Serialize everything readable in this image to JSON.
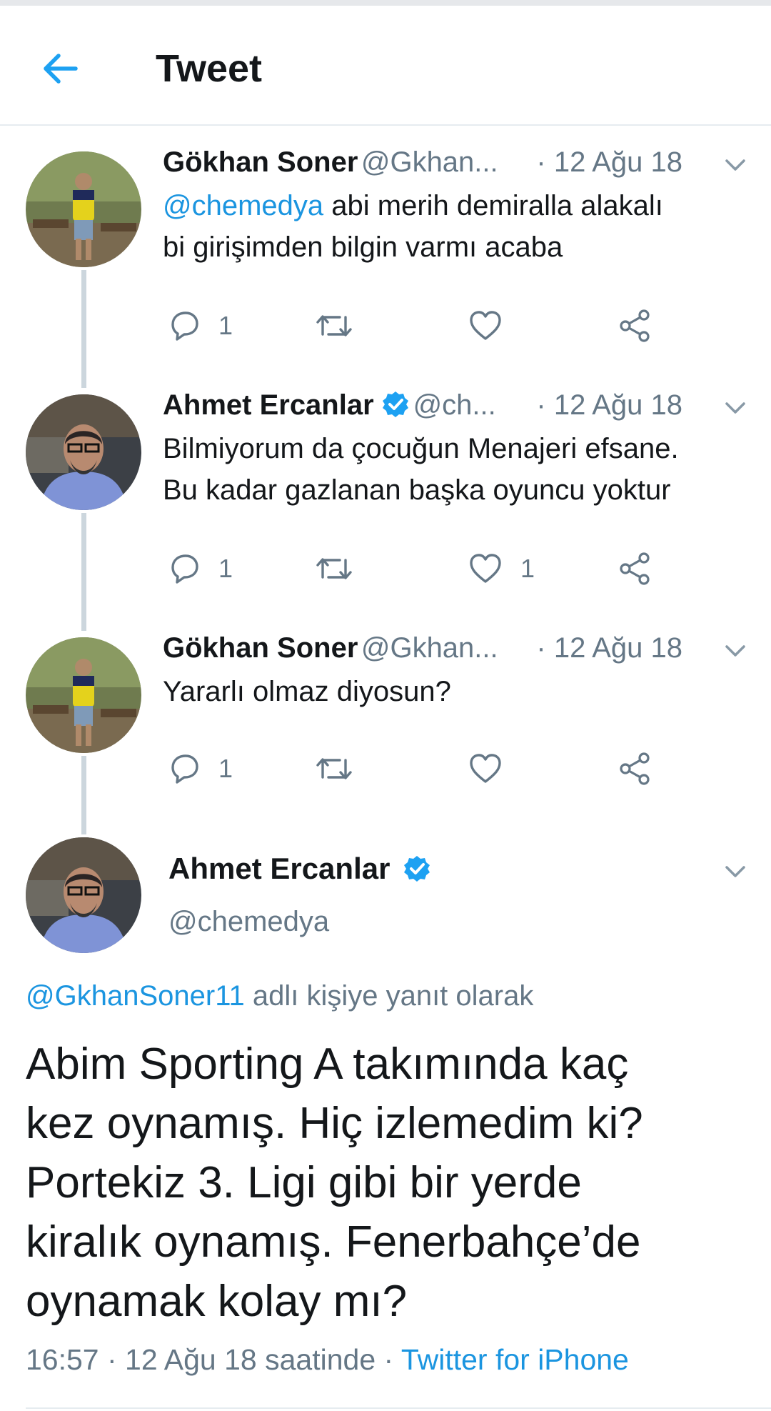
{
  "header": {
    "title": "Tweet"
  },
  "replies": [
    {
      "name": "Gökhan Soner",
      "handle": "@Gkhan...",
      "date": "· 12 Ağu 18",
      "mention": "@chemedya",
      "text_line1": " abi merih demiralla alakalı",
      "text_line2": "bi girişimden bilgin varmı acaba",
      "reply_count": "1",
      "like_count": "",
      "verified": false
    },
    {
      "name": "Ahmet Ercanlar",
      "handle": "@ch...",
      "date": "· 12 Ağu 18",
      "text_line1": "Bilmiyorum da çocuğun Menajeri efsane.",
      "text_line2": "Bu kadar gazlanan başka oyuncu yoktur",
      "reply_count": "1",
      "like_count": "1",
      "verified": true
    },
    {
      "name": "Gökhan Soner",
      "handle": "@Gkhan...",
      "date": "· 12 Ağu 18",
      "text_line1": "Yararlı olmaz diyosun?",
      "reply_count": "1",
      "like_count": "",
      "verified": false
    }
  ],
  "main_tweet": {
    "name": "Ahmet Ercanlar",
    "handle": "@chemedya",
    "reply_to_handle": "@GkhanSoner11",
    "reply_to_suffix": " adlı kişiye yanıt olarak",
    "text_lines": [
      "Abim Sporting A takımında kaç",
      "kez oynamış. Hiç izlemedim ki?",
      "Portekiz 3. Ligi gibi bir yerde",
      "kiralık oynamış. Fenerbahçe’de",
      "oynamak kolay mı?"
    ],
    "time": "16:57",
    "date_text": " · 12 Ağu 18 saatinde · ",
    "source": "Twitter for iPhone"
  },
  "colors": {
    "accent": "#1b95e0",
    "secondary_text": "#657786",
    "thread_line": "#ccd6dd"
  },
  "icons": [
    "back-arrow-icon",
    "chevron-down-icon",
    "reply-icon",
    "retweet-icon",
    "like-icon",
    "share-icon",
    "verified-badge-icon"
  ]
}
